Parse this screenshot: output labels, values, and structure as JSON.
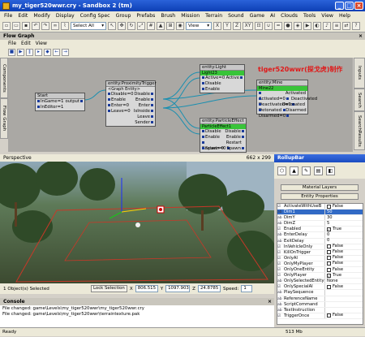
{
  "window": {
    "title": "my_tiger520wwr.cry - Sandbox 2 (tm)"
  },
  "menu": [
    "File",
    "Edit",
    "Modify",
    "Display",
    "Config Spec",
    "Group",
    "Prefabs",
    "Brush",
    "Mission",
    "Terrain",
    "Sound",
    "Game",
    "AI",
    "Clouds",
    "Tools",
    "View",
    "Help"
  ],
  "toolbar": {
    "select_label": "Select All",
    "view_label": "View",
    "axes": [
      "X",
      "Y",
      "Z",
      "XY"
    ]
  },
  "flowgraph": {
    "title": "Flow Graph",
    "menu": [
      "File",
      "Edit",
      "View"
    ],
    "left_tab": "Components",
    "left_tab2": "Flow Graph",
    "right_tabs": [
      "Inputs",
      "Search",
      "SearchResults"
    ],
    "watermark": "tiger520wwr(探戈虎)制作",
    "nodes": {
      "start": {
        "title": "Start",
        "rows": [
          [
            "InGame=1",
            "output"
          ],
          [
            "InEditor=1",
            ""
          ]
        ]
      },
      "proximity": {
        "title": "entity:ProximityTrigger",
        "sub": "<Graph Entity>",
        "rows": [
          [
            "Disable=0",
            "Disable"
          ],
          [
            "Enable",
            "Enable"
          ],
          [
            "Enter=0",
            "Enter"
          ],
          [
            "Leave=0",
            "IsInside"
          ],
          [
            "",
            "Leave"
          ],
          [
            "",
            "Sender"
          ]
        ]
      },
      "light": {
        "title": "entity:Light",
        "sub": "Light23",
        "rows": [
          [
            "Active=0",
            "Active"
          ],
          [
            "Disable",
            ""
          ],
          [
            "Enable",
            ""
          ]
        ]
      },
      "mine": {
        "title": "entity:Mine",
        "sub": "Mine22",
        "rows": [
          [
            "Activated=0",
            "Activated"
          ],
          [
            "Deactivated=0",
            "Deactivated"
          ],
          [
            "Detonated",
            "Detonated"
          ],
          [
            "Disarmed=0",
            "Disarmed"
          ]
        ]
      },
      "particle": {
        "title": "entity:ParticleEffect",
        "sub": "ParticleEffect1",
        "rows": [
          [
            "Disable",
            "Disable"
          ],
          [
            "Enable",
            "Enable"
          ],
          [
            "Restart=0",
            "Restart"
          ],
          [
            "Spawn=0",
            "Spawn"
          ]
        ]
      }
    }
  },
  "viewport": {
    "label": "Perspective",
    "size": "662 x 299"
  },
  "status": {
    "selected": "1 Object(s) Selected",
    "lock": "Lock Selection",
    "x_label": "X",
    "x": "806.515",
    "y_label": "Y",
    "y": "1097.903",
    "z_label": "Z",
    "z": "24.8785",
    "speed_label": "Speed:",
    "speed": "1"
  },
  "console": {
    "title": "Console",
    "lines": [
      "File changed: game\\Levels\\my_tiger520wwr\\my_tiger520wwr.cry",
      "File changed: game\\Levels\\my_tiger520wwr\\terraintexture.pak"
    ]
  },
  "statusbar": {
    "ready": "Ready",
    "mem": "513 Mb"
  },
  "rollup": {
    "title": "RollupBar",
    "material_layers": "Material Layers",
    "entity_properties": "Entity Properties",
    "properties": [
      {
        "name": "ActivateWithUseB",
        "value": "False",
        "checked": false
      },
      {
        "name": "Dim1",
        "value": "50",
        "checked": null,
        "selected": true
      },
      {
        "name": "DimY",
        "value": "30",
        "checked": null
      },
      {
        "name": "DimZ",
        "value": "5",
        "checked": null
      },
      {
        "name": "Enabled",
        "value": "True",
        "checked": true
      },
      {
        "name": "EnterDelay",
        "value": "0",
        "checked": null
      },
      {
        "name": "ExitDelay",
        "value": "0",
        "checked": null
      },
      {
        "name": "InVehicleOnly",
        "value": "False",
        "checked": false
      },
      {
        "name": "KillOnTrigger",
        "value": "False",
        "checked": false
      },
      {
        "name": "OnlyAI",
        "value": "False",
        "checked": false
      },
      {
        "name": "OnlyMyPlayer",
        "value": "False",
        "checked": false
      },
      {
        "name": "OnlyOneEntity",
        "value": "False",
        "checked": false
      },
      {
        "name": "OnlyPlayer",
        "value": "True",
        "checked": true
      },
      {
        "name": "OnlySelectedEntity",
        "value": "None",
        "checked": null
      },
      {
        "name": "OnlySpecialAI",
        "value": "False",
        "checked": false
      },
      {
        "name": "PlaySequence",
        "value": "",
        "checked": null
      },
      {
        "name": "ReferenceName",
        "value": "",
        "checked": null
      },
      {
        "name": "ScriptCommand",
        "value": "",
        "checked": null
      },
      {
        "name": "TextInstruction",
        "value": "",
        "checked": null
      },
      {
        "name": "TriggerOnce",
        "value": "False",
        "checked": false
      }
    ]
  }
}
